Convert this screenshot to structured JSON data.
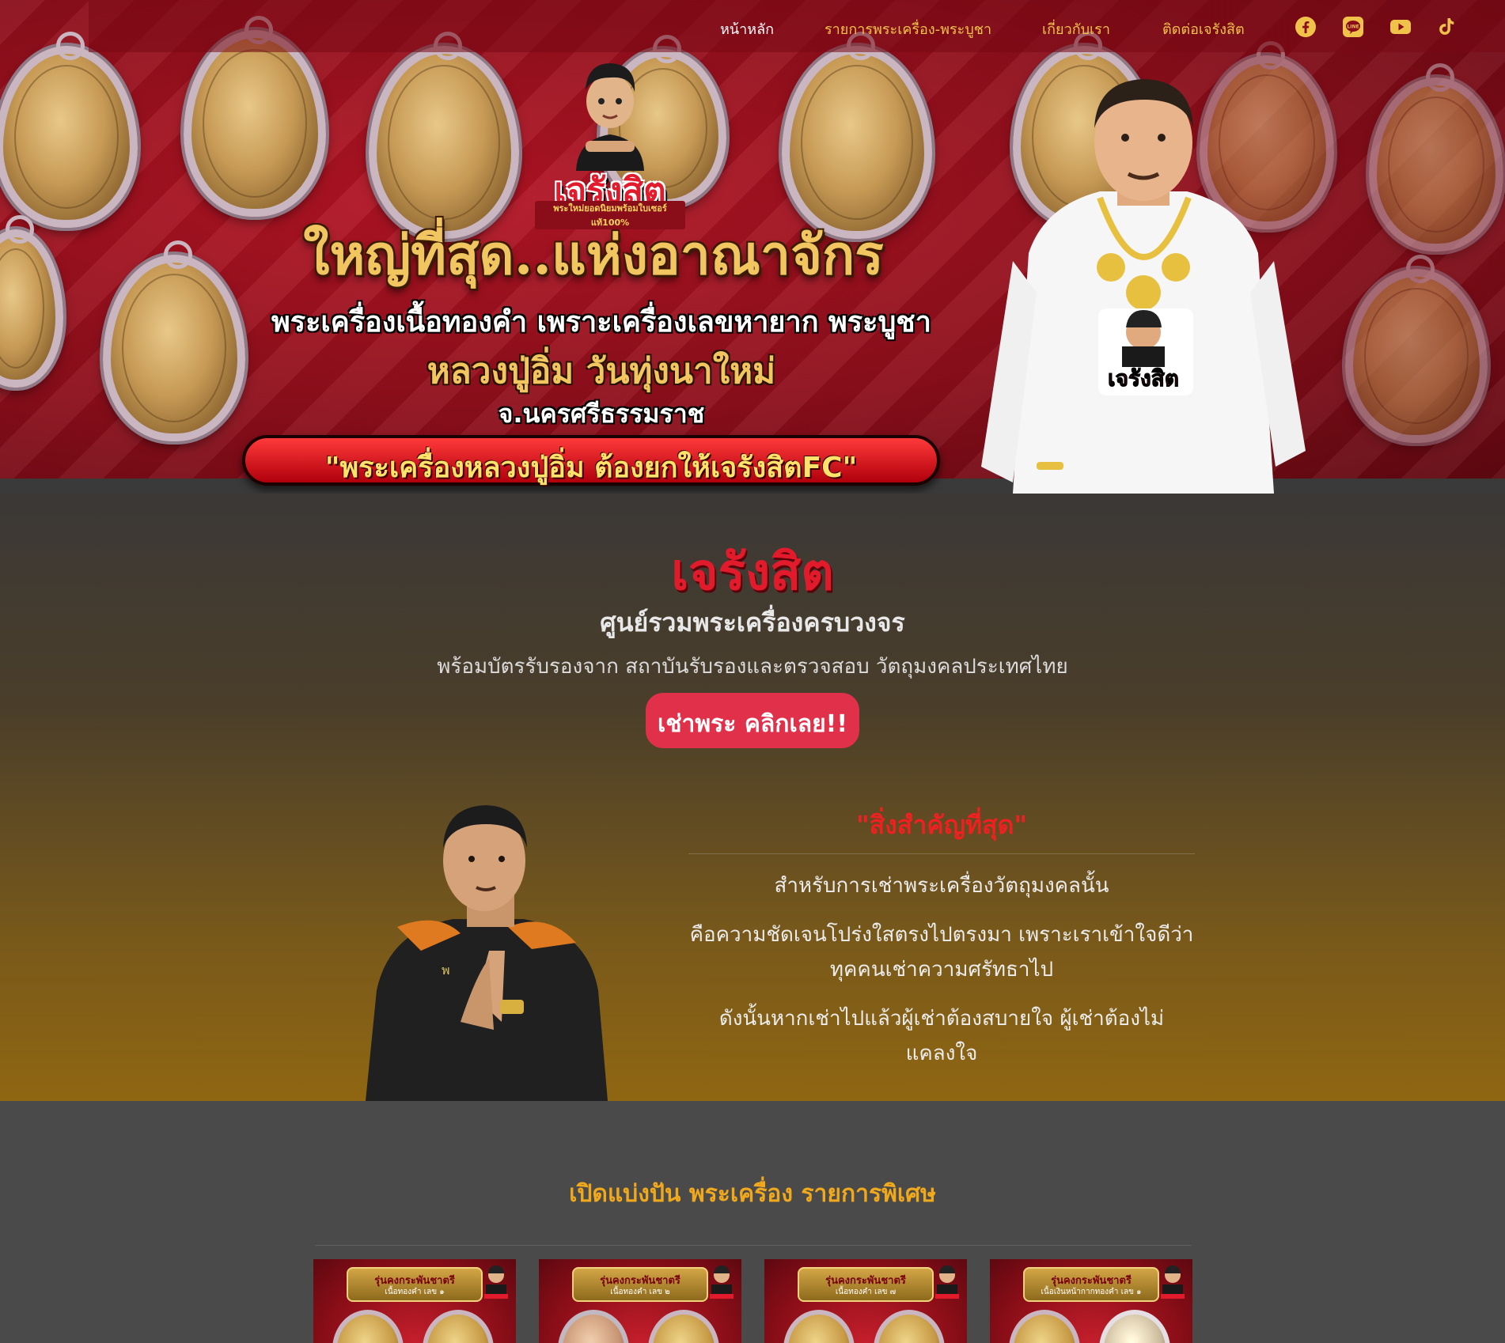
{
  "nav": {
    "items": [
      {
        "label": "หน้าหลัก",
        "active": true
      },
      {
        "label": "รายการพระเครื่อง-พระบูชา",
        "active": false
      },
      {
        "label": "เกี่ยวกับเรา",
        "active": false
      },
      {
        "label": "ติดต่อเจรังสิต",
        "active": false
      }
    ],
    "social": [
      "facebook-icon",
      "line-icon",
      "youtube-icon",
      "tiktok-icon"
    ]
  },
  "hero": {
    "logo_text": "เจรังสิต",
    "logo_sub": "พระใหม่ยอดนิยมพร้อมใบเซอร์ แท้100%",
    "title": "ใหญ่ที่สุด..แห่งอาณาจักร",
    "line1": "พระเครื่องเนื้อทองคำ เพราะเครื่องเลขหายาก พระบูชา",
    "line2": "หลวงปู่อิ่ม วันทุ่งนาใหม่",
    "line3": "จ.นครศรีธรรมราช",
    "pill": "\"พระเครื่องหลวงปู่อิ่ม ต้องยกให้เจรังสิตFC\"",
    "shirt_text": "เจรังสิต"
  },
  "intro": {
    "brand": "เจรังสิต",
    "subtitle": "ศูนย์รวมพระเครื่องครบวงจร",
    "description": "พร้อมบัตรรับรองจาก สถาบันรับรองและตรวจสอบ วัตถุมงคลประเทศไทย",
    "cta": "เช่าพระ คลิกเลย!!",
    "important_title": "\"สิ่งสำคัญที่สุด\"",
    "paragraphs": [
      "สำหรับการเช่าพระเครื่องวัตถุมงคลนั้น",
      "คือความชัดเจนโปร่งใสตรงไปตรงมา เพราะเราเข้าใจดีว่าทุคคนเช่าความศรัทธาไป",
      "ดังนั้นหากเช่าไปแล้วผู้เช่าต้องสบายใจ ผู้เช่าต้องไม่แคลงใจ"
    ]
  },
  "special": {
    "title": "เปิดแบ่งปัน พระเครื่อง รายการพิเศษ",
    "cards": [
      {
        "title": "รุ่นคงกระพันชาตรี",
        "sub": "เนื้อทองคำ เลข ๑"
      },
      {
        "title": "รุ่นคงกระพันชาตรี",
        "sub": "เนื้อทองคำ เลข ๒"
      },
      {
        "title": "รุ่นคงกระพันชาตรี",
        "sub": "เนื้อทองคำ เลข ๗"
      },
      {
        "title": "รุ่นคงกระพันชาตรี",
        "sub": "เนื้อเงินหน้ากากทองคำ เลข ๑"
      }
    ]
  },
  "colors": {
    "accent_red": "#e21b2c",
    "gold": "#f1c560",
    "nav_gold": "#f0c24a",
    "cta": "#e0304a",
    "special_title": "#f0a81c"
  }
}
